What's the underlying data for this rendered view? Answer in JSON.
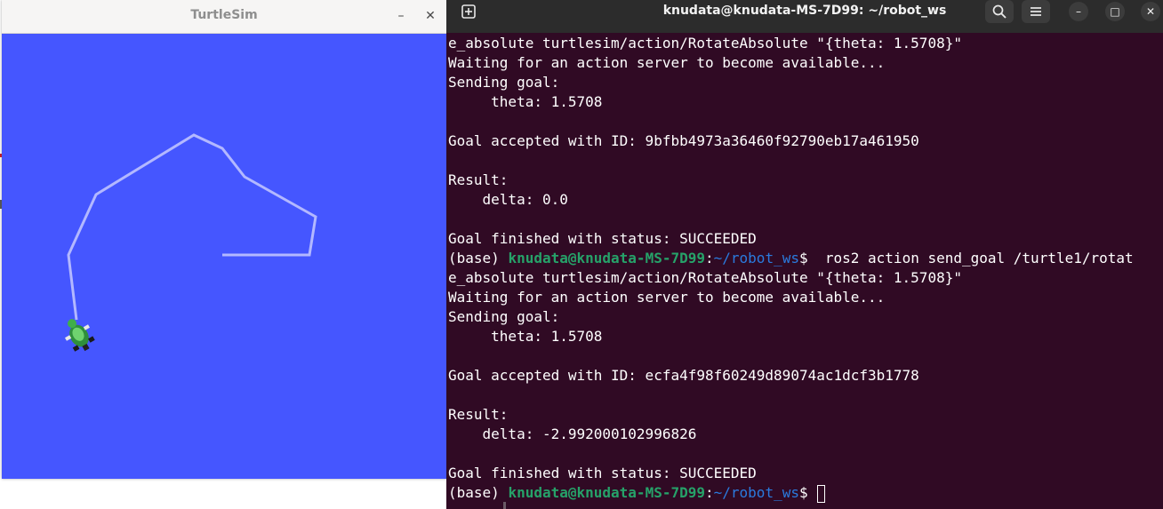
{
  "turtlesim": {
    "title": "TurtleSim",
    "minimize_glyph": "–",
    "close_glyph": "✕",
    "canvas_color": "#4556ff",
    "path_color": "#b3b8ff"
  },
  "terminal": {
    "title": "knudata@knudata-MS-7D99: ~/robot_ws",
    "new_tab_icon": "new-tab-icon",
    "search_icon": "search-icon",
    "menu_icon": "hamburger-menu-icon",
    "min_glyph": "–",
    "max_glyph": "□",
    "close_glyph": "✕",
    "background": "#300a24",
    "lines": [
      {
        "text": "e_absolute turtlesim/action/RotateAbsolute \"{theta: 1.5708}\""
      },
      {
        "text": "Waiting for an action server to become available..."
      },
      {
        "text": "Sending goal:"
      },
      {
        "text": "     theta: 1.5708"
      },
      {
        "text": ""
      },
      {
        "text": "Goal accepted with ID: 9bfbb4973a36460f92790eb17a461950"
      },
      {
        "text": ""
      },
      {
        "text": "Result:"
      },
      {
        "text": "    delta: 0.0"
      },
      {
        "text": ""
      },
      {
        "text": "Goal finished with status: SUCCEEDED"
      },
      {
        "prompt": true,
        "base": "(base) ",
        "user": "knudata@knudata-MS-7D99",
        "colon": ":",
        "path": "~/robot_ws",
        "dollar": "$ ",
        "cmd": " ros2 action send_goal /turtle1/rotat"
      },
      {
        "text": "e_absolute turtlesim/action/RotateAbsolute \"{theta: 1.5708}\""
      },
      {
        "text": "Waiting for an action server to become available..."
      },
      {
        "text": "Sending goal:"
      },
      {
        "text": "     theta: 1.5708"
      },
      {
        "text": ""
      },
      {
        "text": "Goal accepted with ID: ecfa4f98f60249d89074ac1dcf3b1778"
      },
      {
        "text": ""
      },
      {
        "text": "Result:"
      },
      {
        "text": "    delta: -2.992000102996826"
      },
      {
        "text": ""
      },
      {
        "text": "Goal finished with status: SUCCEEDED"
      },
      {
        "prompt": true,
        "cursor": true,
        "base": "(base) ",
        "user": "knudata@knudata-MS-7D99",
        "colon": ":",
        "path": "~/robot_ws",
        "dollar": "$ ",
        "cmd": ""
      }
    ]
  }
}
